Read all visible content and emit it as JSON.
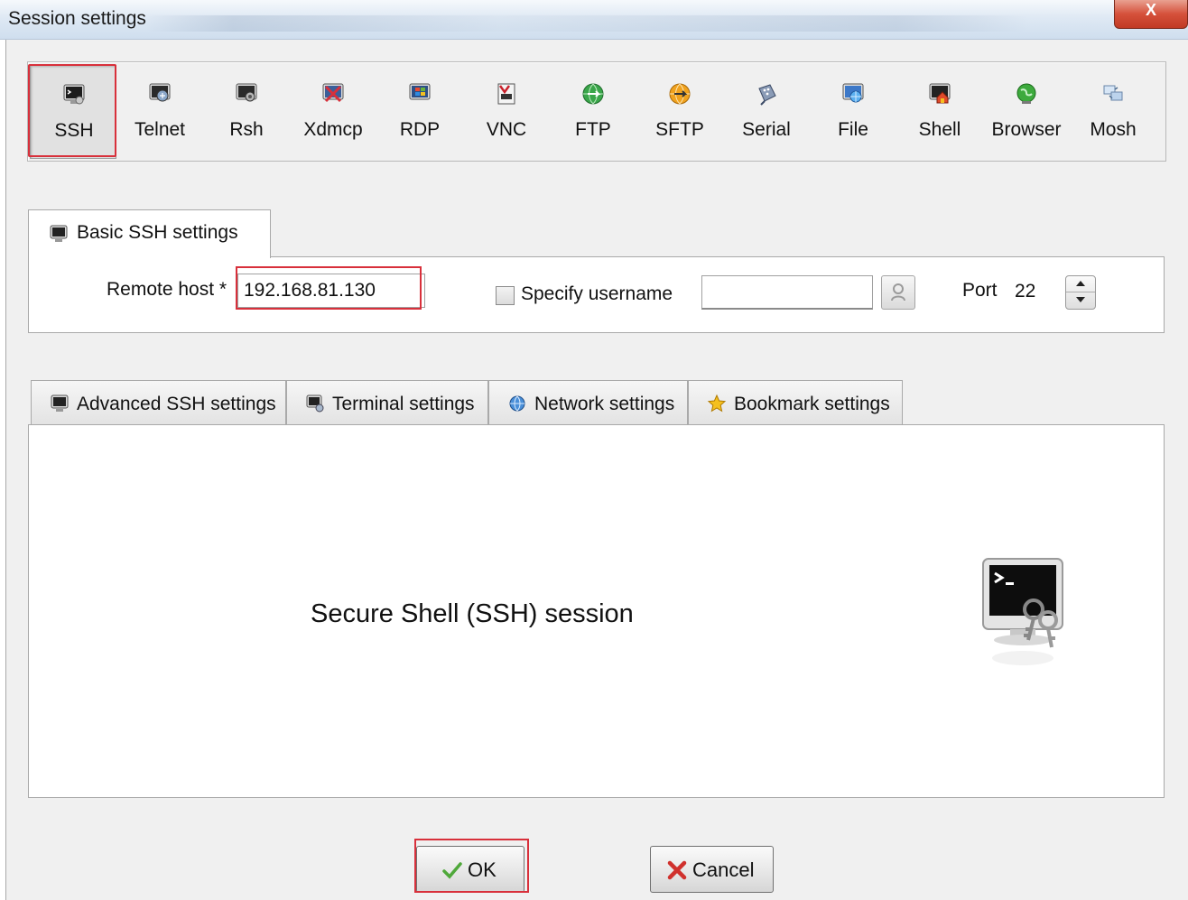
{
  "window": {
    "title": "Session settings",
    "close_glyph": "X"
  },
  "session_types": [
    {
      "label": "SSH",
      "icon": "ssh-terminal-icon",
      "selected": true
    },
    {
      "label": "Telnet",
      "icon": "telnet-icon"
    },
    {
      "label": "Rsh",
      "icon": "rsh-icon"
    },
    {
      "label": "Xdmcp",
      "icon": "xdmcp-icon"
    },
    {
      "label": "RDP",
      "icon": "rdp-windows-icon"
    },
    {
      "label": "VNC",
      "icon": "vnc-icon"
    },
    {
      "label": "FTP",
      "icon": "ftp-globe-icon"
    },
    {
      "label": "SFTP",
      "icon": "sftp-globe-icon"
    },
    {
      "label": "Serial",
      "icon": "serial-plug-icon"
    },
    {
      "label": "File",
      "icon": "file-explorer-icon"
    },
    {
      "label": "Shell",
      "icon": "shell-icon"
    },
    {
      "label": "Browser",
      "icon": "browser-globe-icon"
    },
    {
      "label": "Mosh",
      "icon": "mosh-icon"
    }
  ],
  "basic": {
    "tab_label": "Basic SSH settings",
    "remote_host_label": "Remote host *",
    "remote_host_value": "192.168.81.130",
    "specify_username_label": "Specify username",
    "specify_username_checked": false,
    "username_value": "",
    "port_label": "Port",
    "port_value": "22"
  },
  "sub_tabs": [
    {
      "label": "Advanced SSH settings",
      "icon": "terminal-icon"
    },
    {
      "label": "Terminal settings",
      "icon": "terminal-settings-icon"
    },
    {
      "label": "Network settings",
      "icon": "network-globe-icon"
    },
    {
      "label": "Bookmark settings",
      "icon": "star-icon"
    }
  ],
  "main": {
    "description": "Secure Shell (SSH) session",
    "big_icon": "ssh-terminal-keys-icon"
  },
  "buttons": {
    "ok_label": "OK",
    "cancel_label": "Cancel"
  },
  "colors": {
    "highlight_red": "#d8303b",
    "ok_check_green": "#4fa83a",
    "cancel_x_red": "#d0312d"
  }
}
